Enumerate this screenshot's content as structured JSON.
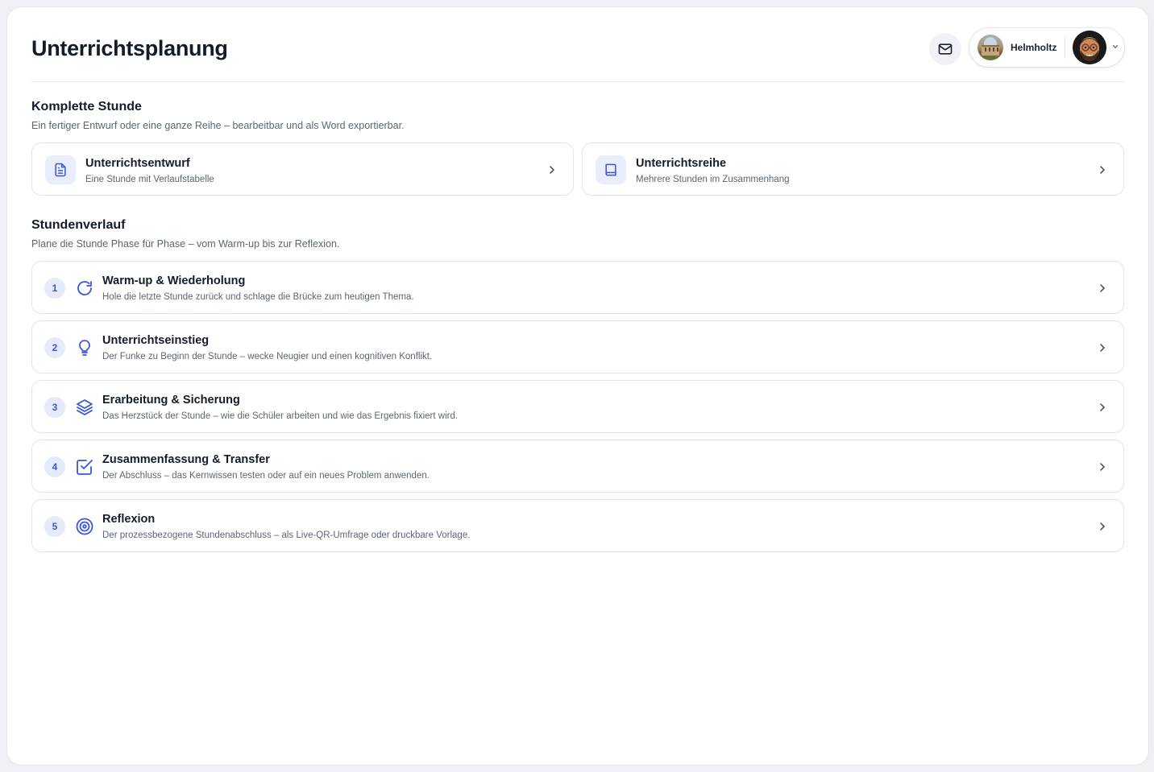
{
  "header": {
    "title": "Unterrichtsplanung",
    "school_name": "Helmholtz"
  },
  "complete_lesson": {
    "title": "Komplette Stunde",
    "subtitle": "Ein fertiger Entwurf oder eine ganze Reihe – bearbeitbar und als Word exportierbar.",
    "cards": [
      {
        "title": "Unterrichtsentwurf",
        "subtitle": "Eine Stunde mit Verlaufstabelle",
        "icon": "document-icon"
      },
      {
        "title": "Unterrichtsreihe",
        "subtitle": "Mehrere Stunden im Zusammenhang",
        "icon": "book-icon"
      }
    ]
  },
  "lesson_flow": {
    "title": "Stundenverlauf",
    "subtitle": "Plane die Stunde Phase für Phase – vom Warm-up bis zur Reflexion.",
    "phases": [
      {
        "number": "1",
        "title": "Warm-up & Wiederholung",
        "subtitle": "Hole die letzte Stunde zurück und schlage die Brücke zum heutigen Thema.",
        "icon": "refresh-icon"
      },
      {
        "number": "2",
        "title": "Unterrichtseinstieg",
        "subtitle": "Der Funke zu Beginn der Stunde – wecke Neugier und einen kognitiven Konflikt.",
        "icon": "lightbulb-icon"
      },
      {
        "number": "3",
        "title": "Erarbeitung & Sicherung",
        "subtitle": "Das Herzstück der Stunde – wie die Schüler arbeiten und wie das Ergebnis fixiert wird.",
        "icon": "layers-icon"
      },
      {
        "number": "4",
        "title": "Zusammenfassung & Transfer",
        "subtitle": "Der Abschluss – das Kernwissen testen oder auf ein neues Problem anwenden.",
        "icon": "checkbox-icon"
      },
      {
        "number": "5",
        "title": "Reflexion",
        "subtitle": "Der prozessbezogene Stundenabschluss – als Live-QR-Umfrage oder druckbare Vorlage.",
        "icon": "target-icon"
      }
    ]
  },
  "colors": {
    "accent": "#3a55d9",
    "accent_bg": "#eaeefc",
    "text": "#141b2b",
    "muted": "#5d6575"
  }
}
